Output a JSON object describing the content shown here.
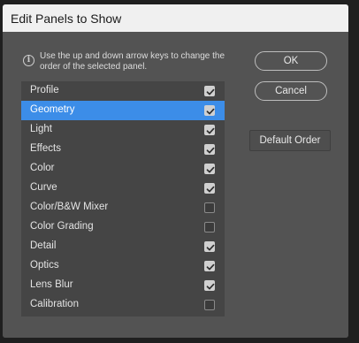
{
  "dialog": {
    "title": "Edit Panels to Show",
    "info_icon": "info-circle-icon",
    "info_text": "Use the up and down arrow keys to change the order of the selected panel."
  },
  "panels": [
    {
      "label": "Profile",
      "checked": true,
      "selected": false
    },
    {
      "label": "Geometry",
      "checked": true,
      "selected": true
    },
    {
      "label": "Light",
      "checked": true,
      "selected": false
    },
    {
      "label": "Effects",
      "checked": true,
      "selected": false
    },
    {
      "label": "Color",
      "checked": true,
      "selected": false
    },
    {
      "label": "Curve",
      "checked": true,
      "selected": false
    },
    {
      "label": "Color/B&W Mixer",
      "checked": false,
      "selected": false
    },
    {
      "label": "Color Grading",
      "checked": false,
      "selected": false
    },
    {
      "label": "Detail",
      "checked": true,
      "selected": false
    },
    {
      "label": "Optics",
      "checked": true,
      "selected": false
    },
    {
      "label": "Lens Blur",
      "checked": true,
      "selected": false
    },
    {
      "label": "Calibration",
      "checked": false,
      "selected": false
    }
  ],
  "buttons": {
    "ok": "OK",
    "cancel": "Cancel",
    "default_order": "Default Order"
  },
  "colors": {
    "selection": "#3c8de8",
    "dialog_bg": "#535353",
    "list_bg": "#454545"
  }
}
